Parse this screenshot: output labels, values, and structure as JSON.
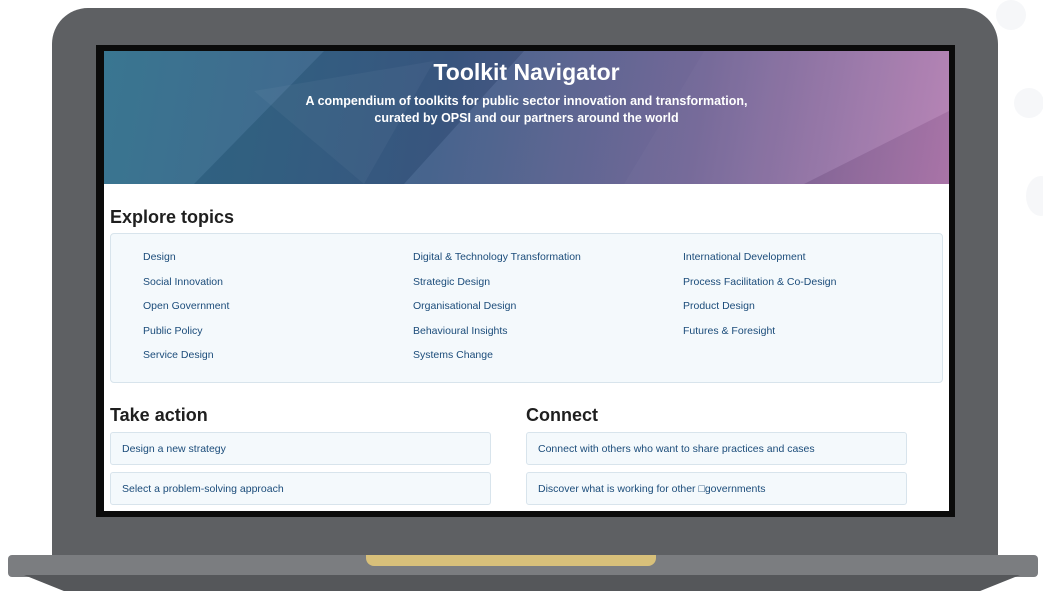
{
  "hero": {
    "title": "Toolkit Navigator",
    "subtitle_line1": "A compendium of toolkits for public sector innovation and transformation,",
    "subtitle_line2": "curated by OPSI and our partners around the world"
  },
  "explore": {
    "heading": "Explore topics",
    "columns": [
      [
        "Design",
        "Social Innovation",
        "Open Government",
        "Public Policy",
        "Service Design"
      ],
      [
        "Digital & Technology Transformation",
        "Strategic Design",
        "Organisational Design",
        "Behavioural Insights",
        "Systems Change"
      ],
      [
        "International Development",
        "Process Facilitation & Co-Design",
        "Product Design",
        "Futures & Foresight"
      ]
    ]
  },
  "take_action": {
    "heading": "Take action",
    "items": [
      "Design a new strategy",
      "Select a problem-solving approach"
    ]
  },
  "connect": {
    "heading": "Connect",
    "items": [
      "Connect with others who want to share practices and cases",
      "Discover what is working for other □governments"
    ]
  },
  "colors": {
    "laptop_frame": "#5e6063",
    "link": "#1b4c7a",
    "panel_bg": "#f4f9fc",
    "hinge": "#d8c07a"
  }
}
